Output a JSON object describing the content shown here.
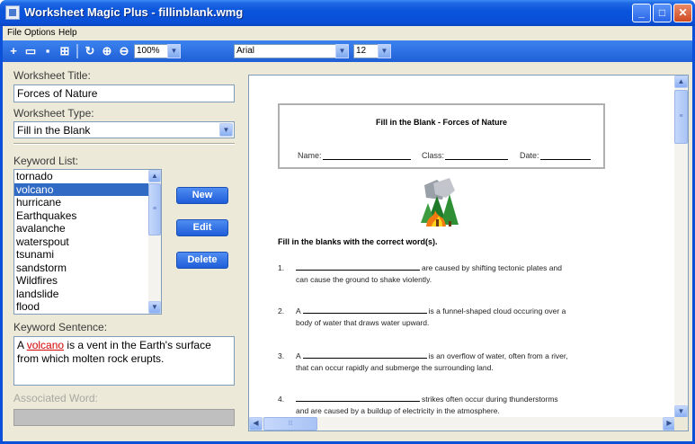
{
  "window": {
    "title": "Worksheet Magic Plus - fillinblank.wmg",
    "minimize": "_",
    "maximize": "□",
    "close": "✕"
  },
  "menu": [
    "File",
    "Options",
    "Help"
  ],
  "toolbar": {
    "zoom": "100%",
    "font": "Arial",
    "size": "12",
    "combo_arrow": "▼"
  },
  "form": {
    "title_label": "Worksheet Title:",
    "title_value": "Forces of Nature",
    "type_label": "Worksheet Type:",
    "type_value": "Fill in the Blank",
    "keyword_label": "Keyword List:",
    "keywords": [
      "tornado",
      "volcano",
      "hurricane",
      "Earthquakes",
      "avalanche",
      "waterspout",
      "tsunami",
      "sandstorm",
      "Wildfires",
      "landslide",
      "flood"
    ],
    "selected_keyword_index": 1,
    "buttons": {
      "new": "New",
      "edit": "Edit",
      "delete": "Delete"
    },
    "sentence_label": "Keyword Sentence:",
    "sentence_prefix": "A ",
    "sentence_keyword": "volcano",
    "sentence_rest": " is a vent in the Earth's surface from which molten rock erupts.",
    "assoc_label": "Associated Word:"
  },
  "worksheet": {
    "title": "Fill in the Blank - Forces of Nature",
    "name_label": "Name:",
    "class_label": "Class:",
    "date_label": "Date:",
    "instructions": "Fill in the blanks with the correct word(s).",
    "questions": [
      {
        "num": "1.",
        "pre": "",
        "post": "are caused by shifting tectonic plates and",
        "line2": "can cause the ground to shake violently."
      },
      {
        "num": "2.",
        "pre": "A",
        "post": "is a funnel-shaped cloud occuring over a",
        "line2": "body of water that draws water upward."
      },
      {
        "num": "3.",
        "pre": "A",
        "post": "is an overflow of water, often from a river,",
        "line2": "that can occur rapidly and submerge the surrounding land."
      },
      {
        "num": "4.",
        "pre": "",
        "post": "strikes often occur during thunderstorms",
        "line2": "and are caused by a buildup of electricity in the atmosphere."
      }
    ]
  },
  "colors": {
    "titlebar": "#0a55dc",
    "selection": "#316ac5",
    "keyword_highlight": "#d40000"
  }
}
